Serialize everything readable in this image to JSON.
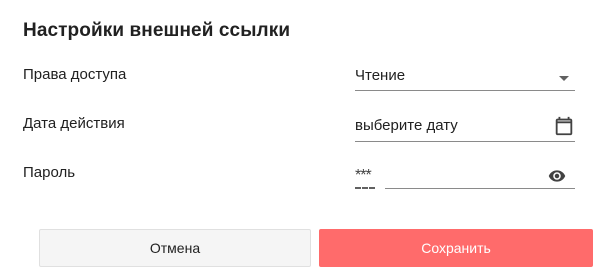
{
  "dialog": {
    "title": "Настройки внешней ссылки",
    "access": {
      "label": "Права доступа",
      "value": "Чтение",
      "icon": "chevron-down-icon"
    },
    "date": {
      "label": "Дата действия",
      "placeholder": "выберите дату",
      "icon": "calendar-icon"
    },
    "password": {
      "label": "Пароль",
      "masked": "***",
      "icon": "eye-icon"
    },
    "buttons": {
      "cancel": "Отмена",
      "save": "Сохранить"
    },
    "colors": {
      "save_button": "#ff6b6b",
      "cancel_button": "#f5f5f5"
    }
  }
}
